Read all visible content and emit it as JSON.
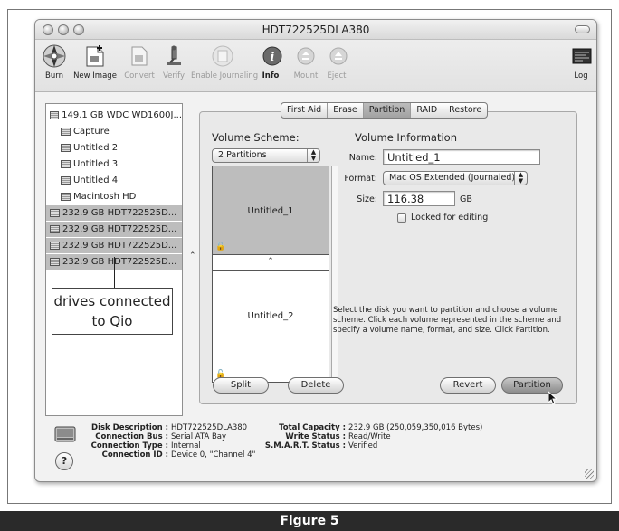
{
  "window": {
    "title": "HDT722525DLA380"
  },
  "toolbar": {
    "items": [
      {
        "label": "Burn",
        "icon": "burn-icon",
        "enabled": true
      },
      {
        "label": "New Image",
        "icon": "new-image-icon",
        "enabled": true
      },
      {
        "label": "Convert",
        "icon": "convert-icon",
        "enabled": false
      },
      {
        "label": "Verify",
        "icon": "verify-icon",
        "enabled": false
      },
      {
        "label": "Enable Journaling",
        "icon": "enable-journaling-icon",
        "enabled": false
      },
      {
        "label": "Info",
        "icon": "info-icon",
        "enabled": true
      },
      {
        "label": "Mount",
        "icon": "mount-icon",
        "enabled": false
      },
      {
        "label": "Eject",
        "icon": "eject-icon",
        "enabled": false
      },
      {
        "label": "Log",
        "icon": "log-icon",
        "enabled": true
      }
    ]
  },
  "sidebar": {
    "items": [
      {
        "label": "149.1 GB WDC WD1600J...",
        "level": 0,
        "selected": false
      },
      {
        "label": "Capture",
        "level": 1,
        "selected": false
      },
      {
        "label": "Untitled 2",
        "level": 1,
        "selected": false
      },
      {
        "label": "Untitled 3",
        "level": 1,
        "selected": false
      },
      {
        "label": "Untitled 4",
        "level": 1,
        "selected": false
      },
      {
        "label": "Macintosh HD",
        "level": 1,
        "selected": false
      },
      {
        "label": "232.9 GB HDT722525D...",
        "level": 0,
        "selected": true
      },
      {
        "label": "232.9 GB HDT722525D...",
        "level": 0,
        "selected": true
      },
      {
        "label": "232.9 GB HDT722525D...",
        "level": 0,
        "selected": true
      },
      {
        "label": "232.9 GB HDT722525D...",
        "level": 0,
        "selected": true
      }
    ]
  },
  "annotation": {
    "line1": "drives connected",
    "line2": "to Qio"
  },
  "tabs": [
    {
      "label": "First Aid",
      "active": false
    },
    {
      "label": "Erase",
      "active": false
    },
    {
      "label": "Partition",
      "active": true
    },
    {
      "label": "RAID",
      "active": false
    },
    {
      "label": "Restore",
      "active": false
    }
  ],
  "partition": {
    "scheme_label": "Volume Scheme:",
    "scheme_value": "2 Partitions",
    "volumes": [
      {
        "name": "Untitled_1"
      },
      {
        "name": "Untitled_2"
      }
    ],
    "info_label": "Volume Information",
    "name_label": "Name:",
    "name_value": "Untitled_1",
    "format_label": "Format:",
    "format_value": "Mac OS Extended (Journaled)",
    "size_label": "Size:",
    "size_value": "116.38",
    "size_unit": "GB",
    "locked_label": "Locked for editing",
    "locked": false,
    "help_text": "Select the disk you want to partition and choose a volume scheme. Click each volume represented in the scheme and specify a volume name, format, and size. Click Partition.",
    "split_label": "Split",
    "delete_label": "Delete",
    "revert_label": "Revert",
    "partition_label": "Partition"
  },
  "disk_info": {
    "description_key": "Disk Description :",
    "description_val": "HDT722525DLA380",
    "bus_key": "Connection Bus :",
    "bus_val": "Serial ATA Bay",
    "type_key": "Connection Type :",
    "type_val": "Internal",
    "id_key": "Connection ID :",
    "id_val": "Device 0, \"Channel 4\"",
    "capacity_key": "Total Capacity :",
    "capacity_val": "232.9 GB (250,059,350,016 Bytes)",
    "write_key": "Write Status :",
    "write_val": "Read/Write",
    "smart_key": "S.M.A.R.T. Status :",
    "smart_val": "Verified"
  },
  "help_button": "?",
  "figure_caption": "Figure 5"
}
